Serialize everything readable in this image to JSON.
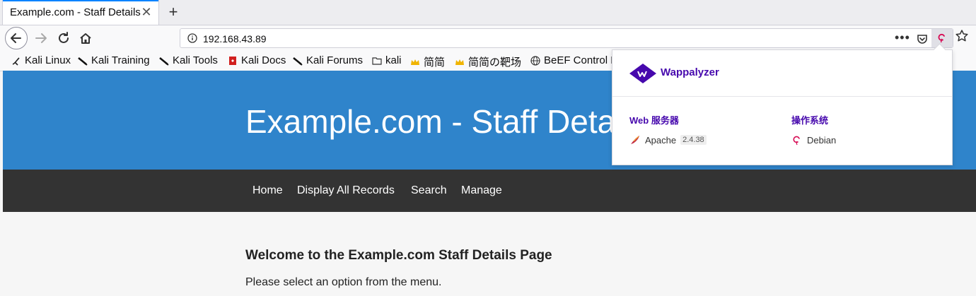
{
  "browser": {
    "tab_title": "Example.com - Staff Details",
    "tab_close": "✕",
    "new_tab": "+",
    "url": "192.168.43.89",
    "url_more": "•••"
  },
  "bookmarks": [
    {
      "label": "Kali Linux",
      "icon": "kali-icon"
    },
    {
      "label": "Kali Training",
      "icon": "kali-icon"
    },
    {
      "label": "Kali Tools",
      "icon": "kali-icon"
    },
    {
      "label": "Kali Docs",
      "icon": "docs-icon"
    },
    {
      "label": "Kali Forums",
      "icon": "kali-icon"
    },
    {
      "label": "kali",
      "icon": "folder-icon"
    },
    {
      "label": "简简",
      "icon": "crown-icon"
    },
    {
      "label": "简简の靶场",
      "icon": "crown-icon"
    },
    {
      "label": "BeEF Control P",
      "icon": "globe-icon"
    }
  ],
  "page": {
    "title": "Example.com - Staff Details",
    "menu": [
      "Home",
      "Display All Records",
      "Search",
      "Manage"
    ],
    "heading": "Welcome to the Example.com Staff Details Page",
    "text": "Please select an option from the menu."
  },
  "wappalyzer": {
    "name": "Wappalyzer",
    "categories": [
      {
        "name": "Web 服务器",
        "tech": "Apache",
        "version": "2.4.38",
        "icon": "apache-feather-icon"
      },
      {
        "name": "操作系统",
        "tech": "Debian",
        "version": "",
        "icon": "debian-icon"
      }
    ]
  },
  "colors": {
    "hero": "#2f84cb",
    "menu": "#333333",
    "wappalyzer": "#4608ad"
  }
}
